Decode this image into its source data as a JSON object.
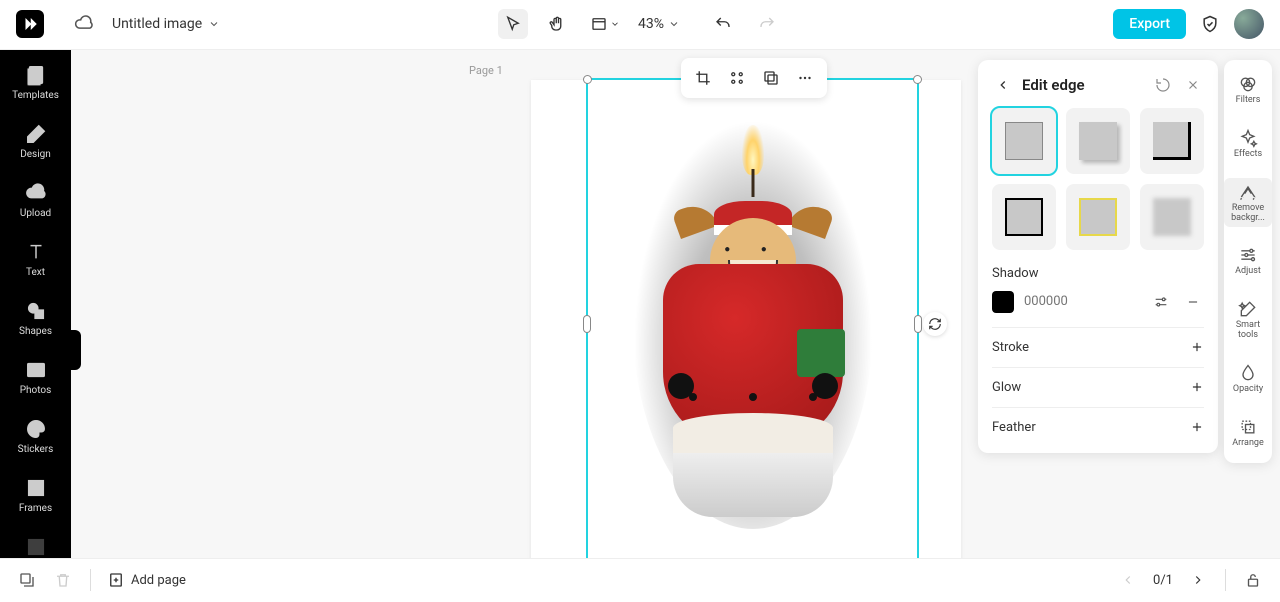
{
  "header": {
    "doc_title": "Untitled image",
    "zoom": "43%",
    "export_label": "Export"
  },
  "left_rail": {
    "items": [
      {
        "label": "Templates"
      },
      {
        "label": "Design"
      },
      {
        "label": "Upload"
      },
      {
        "label": "Text"
      },
      {
        "label": "Shapes"
      },
      {
        "label": "Photos"
      },
      {
        "label": "Stickers"
      },
      {
        "label": "Frames"
      }
    ]
  },
  "canvas": {
    "page_label": "Page 1"
  },
  "edit_panel": {
    "title": "Edit edge",
    "sections": {
      "shadow": "Shadow",
      "stroke": "Stroke",
      "glow": "Glow",
      "feather": "Feather"
    },
    "shadow_color_placeholder": "000000"
  },
  "right_rail": {
    "items": [
      {
        "label": "Filters"
      },
      {
        "label": "Effects"
      },
      {
        "label": "Remove backgr..."
      },
      {
        "label": "Adjust"
      },
      {
        "label": "Smart tools"
      },
      {
        "label": "Opacity"
      },
      {
        "label": "Arrange"
      }
    ]
  },
  "bottom": {
    "add_page": "Add page",
    "page_count": "0/1"
  }
}
